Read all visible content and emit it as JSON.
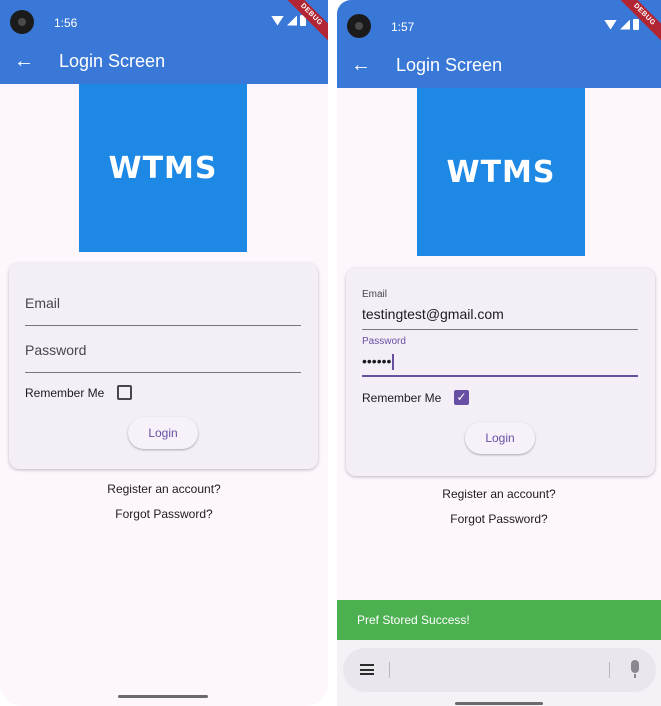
{
  "screens": [
    {
      "status": {
        "time": "1:56"
      },
      "debug_banner": "DEBUG",
      "appbar": {
        "title": "Login Screen"
      },
      "logo": "WTMS",
      "form": {
        "email_placeholder": "Email",
        "password_placeholder": "Password",
        "remember_label": "Remember Me",
        "remember_checked": false,
        "login_label": "Login"
      },
      "links": {
        "register": "Register an account?",
        "forgot": "Forgot Password?"
      }
    },
    {
      "status": {
        "time": "1:57"
      },
      "debug_banner": "DEBUG",
      "appbar": {
        "title": "Login Screen"
      },
      "logo": "WTMS",
      "form": {
        "email_label": "Email",
        "email_value": "testingtest@gmail.com",
        "password_label": "Password",
        "password_value": "••••••",
        "remember_label": "Remember Me",
        "remember_checked": true,
        "login_label": "Login"
      },
      "links": {
        "register": "Register an account?",
        "forgot": "Forgot Password?"
      },
      "snackbar": "Pref Stored Success!",
      "colors": {
        "appbar": "#3a78d8",
        "logo_bg": "#1e88e5",
        "accent": "#6750a4",
        "snackbar": "#4caf50"
      }
    }
  ]
}
